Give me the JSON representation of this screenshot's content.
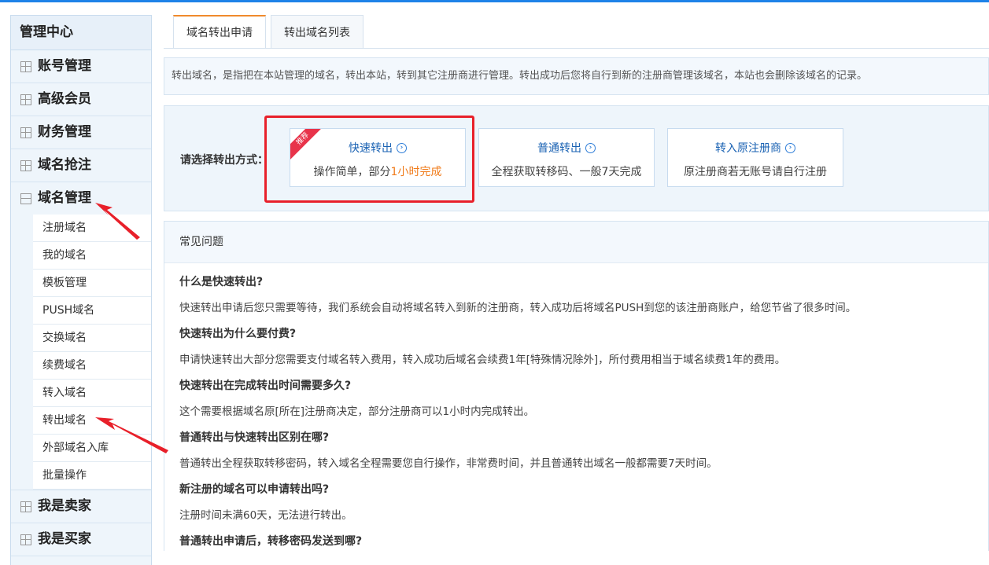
{
  "sidebar": {
    "title": "管理中心",
    "groups_top": [
      {
        "label": "账号管理"
      },
      {
        "label": "高级会员"
      },
      {
        "label": "财务管理"
      },
      {
        "label": "域名抢注"
      }
    ],
    "expanded_group": {
      "label": "域名管理"
    },
    "subitems": [
      {
        "label": "注册域名"
      },
      {
        "label": "我的域名"
      },
      {
        "label": "模板管理"
      },
      {
        "label": "PUSH域名"
      },
      {
        "label": "交换域名"
      },
      {
        "label": "续费域名"
      },
      {
        "label": "转入域名"
      },
      {
        "label": "转出域名"
      },
      {
        "label": "外部域名入库"
      },
      {
        "label": "批量操作"
      }
    ],
    "groups_bottom": [
      {
        "label": "我是卖家"
      },
      {
        "label": "我是买家"
      }
    ]
  },
  "tabs": [
    {
      "label": "域名转出申请",
      "active": true
    },
    {
      "label": "转出域名列表",
      "active": false
    }
  ],
  "notice": "转出域名，是指把在本站管理的域名，转出本站，转到其它注册商进行管理。转出成功后您将自行到新的注册商管理该域名，本站也会删除该域名的记录。",
  "transfer": {
    "label": "请选择转出方式：",
    "options": [
      {
        "title": "快速转出",
        "desc_prefix": "操作简单，部分",
        "desc_highlight": "1小时完成",
        "badge": "推荐"
      },
      {
        "title": "普通转出",
        "desc": "全程获取转移码、一般7天完成"
      },
      {
        "title": "转入原注册商",
        "desc": "原注册商若无账号请自行注册"
      }
    ]
  },
  "faq": {
    "header": "常见问题",
    "items": [
      {
        "q": "什么是快速转出?",
        "a": "快速转出申请后您只需要等待，我们系统会自动将域名转入到新的注册商，转入成功后将域名PUSH到您的该注册商账户，给您节省了很多时间。"
      },
      {
        "q": "快速转出为什么要付费?",
        "a": "申请快速转出大部分您需要支付域名转入费用，转入成功后域名会续费1年[特殊情况除外]，所付费用相当于域名续费1年的费用。"
      },
      {
        "q": "快速转出在完成转出时间需要多久?",
        "a": "这个需要根据域名原[所在]注册商决定，部分注册商可以1小时内完成转出。"
      },
      {
        "q": "普通转出与快速转出区别在哪?",
        "a": "普通转出全程获取转移密码，转入域名全程需要您自行操作，非常费时间，并且普通转出域名一般都需要7天时间。"
      },
      {
        "q": "新注册的域名可以申请转出吗?",
        "a": "注册时间未满60天，无法进行转出。"
      },
      {
        "q": "普通转出申请后，转移密码发送到哪?",
        "a": ""
      }
    ]
  },
  "colors": {
    "accent": "#1e82e8",
    "link": "#1a62b3",
    "highlight": "#f07b1a",
    "annotation": "#e8202a"
  }
}
